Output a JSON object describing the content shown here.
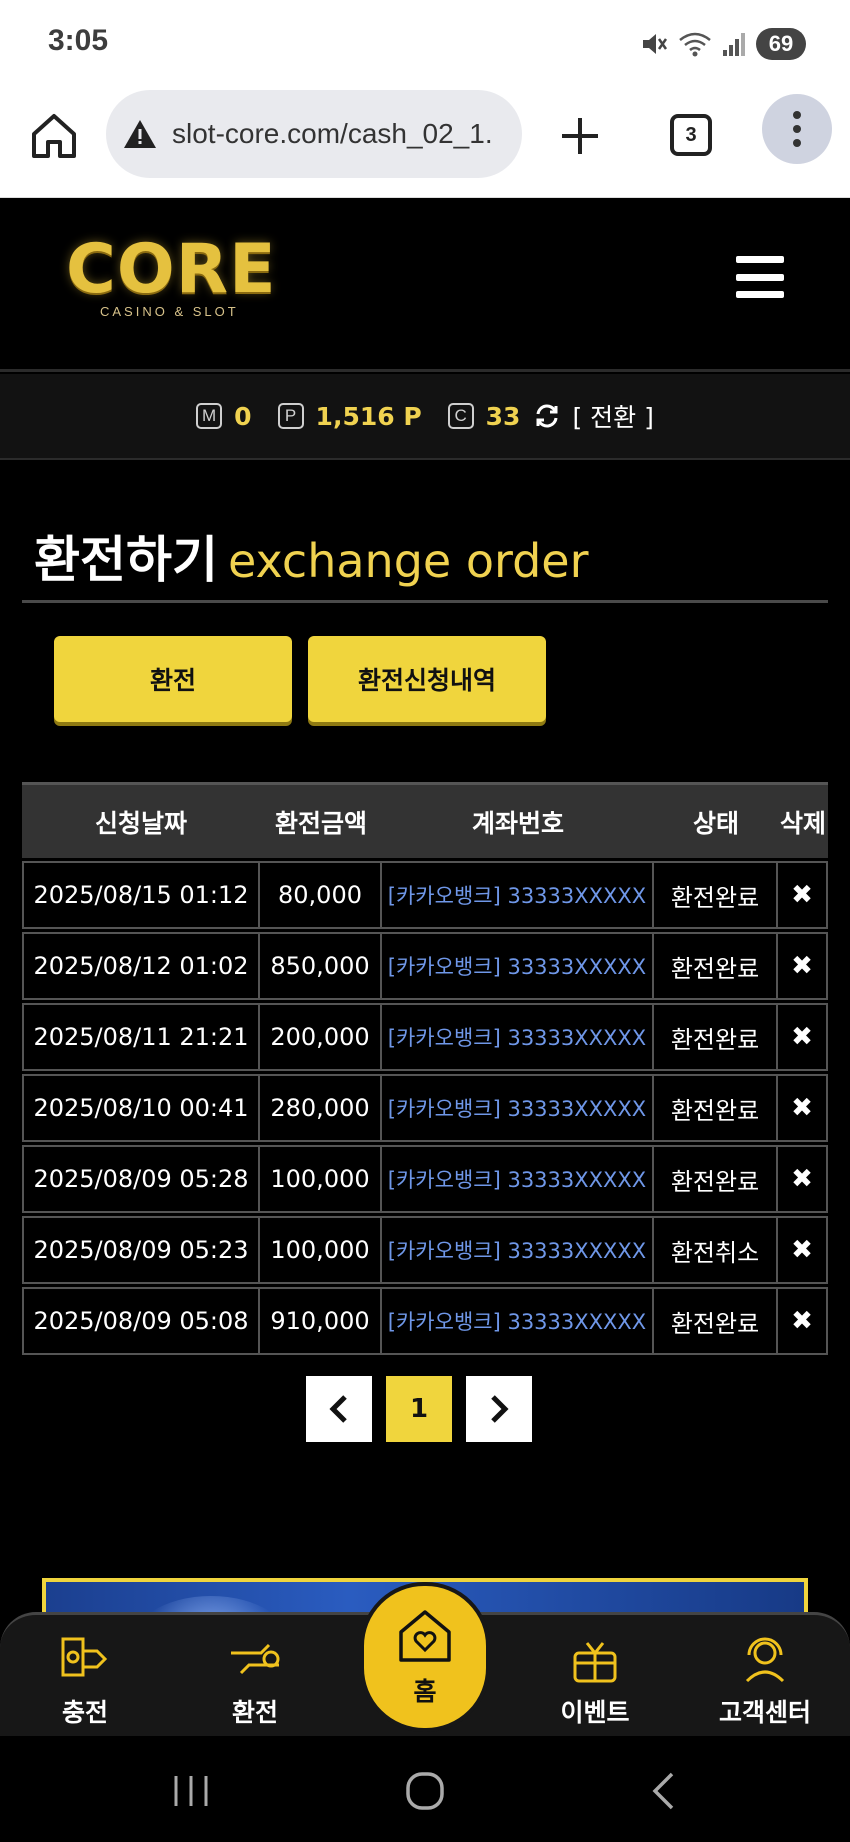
{
  "status_bar": {
    "time": "3:05",
    "battery": "69"
  },
  "browser": {
    "url": "slot-core.com/cash_02_1.",
    "tab_count": "3"
  },
  "header": {
    "logo_text": "CORE",
    "logo_subtitle": "CASINO & SLOT"
  },
  "points": {
    "m_badge": "M",
    "m_value": "0",
    "p_badge": "P",
    "p_value": "1,516 P",
    "c_badge": "C",
    "c_value": "33",
    "switch_label": "[ 전환 ]"
  },
  "page": {
    "title_ko": "환전하기",
    "title_en": "exchange order"
  },
  "buttons": {
    "exchange": "환전",
    "history": "환전신청내역"
  },
  "table": {
    "headers": [
      "신청날짜",
      "환전금액",
      "계좌번호",
      "상태",
      "삭제"
    ],
    "rows": [
      {
        "date": "2025/08/15 01:12",
        "amount": "80,000",
        "account": "[카카오뱅크] 33333XXXXX",
        "status": "환전완료"
      },
      {
        "date": "2025/08/12 01:02",
        "amount": "850,000",
        "account": "[카카오뱅크] 33333XXXXX",
        "status": "환전완료"
      },
      {
        "date": "2025/08/11 21:21",
        "amount": "200,000",
        "account": "[카카오뱅크] 33333XXXXX",
        "status": "환전완료"
      },
      {
        "date": "2025/08/10 00:41",
        "amount": "280,000",
        "account": "[카카오뱅크] 33333XXXXX",
        "status": "환전완료"
      },
      {
        "date": "2025/08/09 05:28",
        "amount": "100,000",
        "account": "[카카오뱅크] 33333XXXXX",
        "status": "환전완료"
      },
      {
        "date": "2025/08/09 05:23",
        "amount": "100,000",
        "account": "[카카오뱅크] 33333XXXXX",
        "status": "환전취소"
      },
      {
        "date": "2025/08/09 05:08",
        "amount": "910,000",
        "account": "[카카오뱅크] 33333XXXXX",
        "status": "환전완료"
      }
    ],
    "delete_glyph": "✖"
  },
  "pagination": {
    "prev": "‹",
    "current": "1",
    "next": "›"
  },
  "bottom_nav": {
    "charge": "충전",
    "exchange": "환전",
    "home": "홈",
    "event": "이벤트",
    "support": "고객센터"
  },
  "colors": {
    "accent": "#f0d53d",
    "link": "#6f97e8",
    "background": "#000000"
  }
}
